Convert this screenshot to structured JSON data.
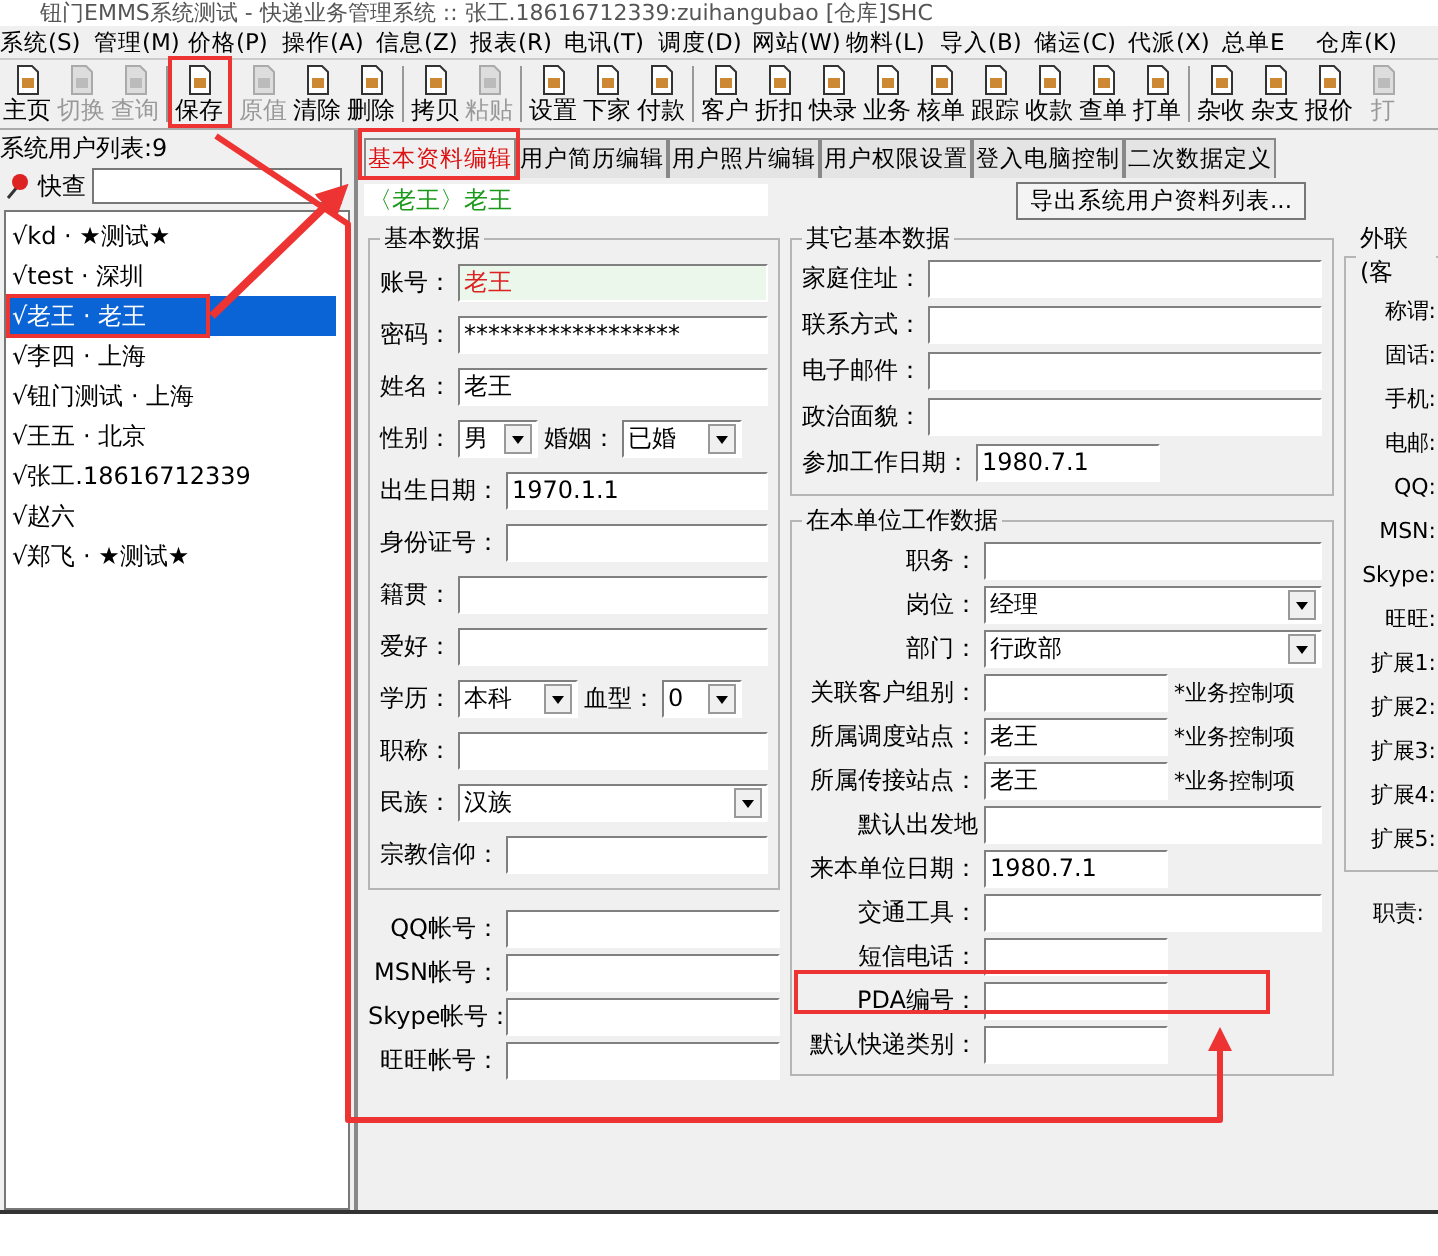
{
  "window": {
    "title": "钮门EMMS系统测试 - 快递业务管理系统 :: 张工.18616712339:zuihangubao [仓库]SHC"
  },
  "menu": [
    "系统(S)",
    "管理(M)",
    "价格(P)",
    "操作(A)",
    "信息(Z)",
    "报表(R)",
    "电讯(T)",
    "调度(D)",
    "网站(W)",
    "物料(L)",
    "导入(B)",
    "储运(C)",
    "代派(X)",
    "总单E",
    "仓库(K)"
  ],
  "toolbar_groups": [
    {
      "buttons": [
        {
          "label": "主页",
          "disabled": false
        },
        {
          "label": "切换",
          "disabled": true
        },
        {
          "label": "查询",
          "disabled": true
        }
      ]
    },
    {
      "buttons": [
        {
          "label": "保存",
          "disabled": false
        }
      ]
    },
    {
      "buttons": [
        {
          "label": "原值",
          "disabled": true
        },
        {
          "label": "清除",
          "disabled": false
        },
        {
          "label": "删除",
          "disabled": false
        }
      ]
    },
    {
      "buttons": [
        {
          "label": "拷贝",
          "disabled": false
        },
        {
          "label": "粘贴",
          "disabled": true
        }
      ]
    },
    {
      "buttons": [
        {
          "label": "设置",
          "disabled": false
        },
        {
          "label": "下家",
          "disabled": false
        },
        {
          "label": "付款",
          "disabled": false
        }
      ]
    },
    {
      "buttons": [
        {
          "label": "客户",
          "disabled": false
        },
        {
          "label": "折扣",
          "disabled": false
        },
        {
          "label": "快录",
          "disabled": false
        },
        {
          "label": "业务",
          "disabled": false
        },
        {
          "label": "核单",
          "disabled": false
        },
        {
          "label": "跟踪",
          "disabled": false
        },
        {
          "label": "收款",
          "disabled": false
        },
        {
          "label": "查单",
          "disabled": false
        },
        {
          "label": "打单",
          "disabled": false
        }
      ]
    },
    {
      "buttons": [
        {
          "label": "杂收",
          "disabled": false
        },
        {
          "label": "杂支",
          "disabled": false
        },
        {
          "label": "报价",
          "disabled": false
        },
        {
          "label": "打",
          "disabled": true
        }
      ]
    }
  ],
  "user_list": {
    "title": "系统用户列表:9",
    "search_label": "快查",
    "items": [
      {
        "label": "√kd · ★测试★",
        "selected": false
      },
      {
        "label": "√test · 深圳",
        "selected": false
      },
      {
        "label": "√老王 · 老王",
        "selected": true
      },
      {
        "label": "√李四 · 上海",
        "selected": false
      },
      {
        "label": "√钮门测试 · 上海",
        "selected": false
      },
      {
        "label": "√王五 · 北京",
        "selected": false
      },
      {
        "label": "√张工.18616712339",
        "selected": false
      },
      {
        "label": "√赵六",
        "selected": false
      },
      {
        "label": "√郑飞 · ★测试★",
        "selected": false
      }
    ]
  },
  "tabs": [
    {
      "label": "基本资料编辑",
      "selected": true
    },
    {
      "label": "用户简历编辑",
      "selected": false
    },
    {
      "label": "用户照片编辑",
      "selected": false
    },
    {
      "label": "用户权限设置",
      "selected": false
    },
    {
      "label": "登入电脑控制",
      "selected": false
    },
    {
      "label": "二次数据定义",
      "selected": false
    }
  ],
  "record_name": "〈老王〉老王",
  "export_button": "导出系统用户资料列表...",
  "basic_group": {
    "title": "基本数据",
    "rows": [
      {
        "fields": [
          {
            "label": "账号：",
            "value": "老王",
            "kind": "account"
          }
        ]
      },
      {
        "fields": [
          {
            "label": "密码：",
            "value": "******************",
            "kind": "text"
          }
        ]
      },
      {
        "fields": [
          {
            "label": "姓名：",
            "value": "老王",
            "kind": "text"
          }
        ]
      },
      {
        "fields": [
          {
            "label": "性别：",
            "value": "男",
            "kind": "select_small"
          },
          {
            "label": "婚姻：",
            "value": "已婚",
            "kind": "select_mid"
          }
        ]
      },
      {
        "fields": [
          {
            "label": "出生日期：",
            "value": "1970.1.1",
            "kind": "text"
          }
        ]
      },
      {
        "fields": [
          {
            "label": "身份证号：",
            "kind": "text"
          }
        ]
      },
      {
        "fields": [
          {
            "label": "籍贯：",
            "kind": "text"
          }
        ]
      },
      {
        "fields": [
          {
            "label": "爱好：",
            "kind": "text"
          }
        ]
      },
      {
        "fields": [
          {
            "label": "学历：",
            "value": "本科",
            "kind": "select_mid"
          },
          {
            "label": "血型：",
            "value": "0",
            "kind": "select_small"
          }
        ]
      },
      {
        "fields": [
          {
            "label": "职称：",
            "kind": "text"
          }
        ]
      },
      {
        "fields": [
          {
            "label": "民族：",
            "value": "汉族",
            "kind": "select"
          }
        ]
      },
      {
        "fields": [
          {
            "label": "宗教信仰：",
            "kind": "text"
          }
        ]
      }
    ]
  },
  "accounts": [
    {
      "label": "QQ帐号：",
      "kind": "text"
    },
    {
      "label": "MSN帐号：",
      "kind": "text"
    },
    {
      "label": "Skype帐号：",
      "kind": "text"
    },
    {
      "label": "旺旺帐号：",
      "kind": "text"
    }
  ],
  "other_group": {
    "title": "其它基本数据",
    "fields": [
      {
        "label": "家庭住址：",
        "kind": "text"
      },
      {
        "label": "联系方式：",
        "kind": "text"
      },
      {
        "label": "电子邮件：",
        "kind": "text"
      },
      {
        "label": "政治面貌：",
        "kind": "text"
      },
      {
        "label": "参加工作日期：",
        "value": "1980.7.1",
        "kind": "short"
      }
    ]
  },
  "work_group": {
    "title": "在本单位工作数据",
    "fields": [
      {
        "label": "职务：",
        "kind": "text"
      },
      {
        "label": "岗位：",
        "value": "经理",
        "kind": "select"
      },
      {
        "label": "部门：",
        "value": "行政部",
        "kind": "select"
      },
      {
        "label": "关联客户组别：",
        "kind": "short",
        "note": "*业务控制项"
      },
      {
        "label": "所属调度站点：",
        "value": "老王",
        "kind": "short",
        "note": "*业务控制项"
      },
      {
        "label": "所属传接站点：",
        "value": "老王",
        "kind": "short",
        "note": "*业务控制项"
      },
      {
        "label": "默认出发地",
        "kind": "text"
      },
      {
        "label": "来本单位日期：",
        "value": "1980.7.1",
        "kind": "short"
      },
      {
        "label": "交通工具：",
        "kind": "text"
      },
      {
        "label": "短信电话：",
        "kind": "short"
      },
      {
        "label": "PDA编号：",
        "kind": "short"
      },
      {
        "label": "默认快递类别：",
        "kind": "short"
      }
    ]
  },
  "contact_group": {
    "title": "外联(客",
    "labels": [
      "称谓:",
      "固话:",
      "手机:",
      "电邮:",
      "QQ:",
      "MSN:",
      "Skype:",
      "旺旺:",
      "扩展1:",
      "扩展2:",
      "扩展3:",
      "扩展4:",
      "扩展5:"
    ]
  },
  "duty_label": "职责:"
}
